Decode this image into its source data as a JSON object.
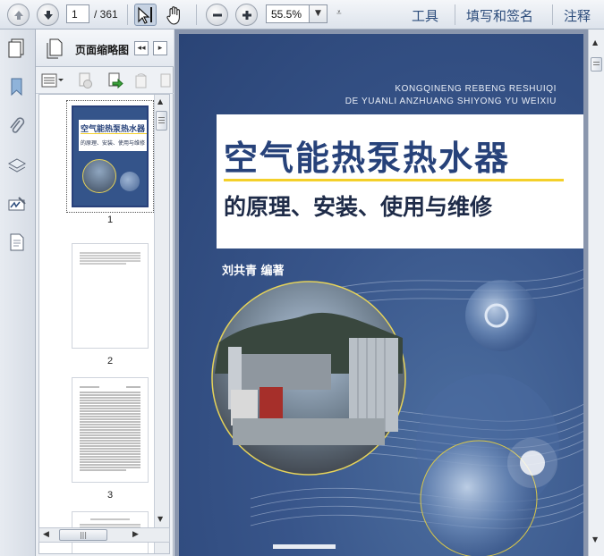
{
  "toolbar": {
    "page_current": "1",
    "page_total": "/ 361",
    "zoom_value": "55.5%",
    "menu_tools": "工具",
    "menu_sign": "填写和签名",
    "menu_comment": "注释",
    "icons": [
      "up-arrow-icon",
      "down-arrow-icon",
      "select-cursor-icon",
      "hand-icon",
      "zoom-out-icon",
      "zoom-in-icon",
      "chevron-down-icon",
      "more-icon"
    ]
  },
  "panel": {
    "title": "页面缩略图",
    "thumbnails": [
      {
        "label": "1"
      },
      {
        "label": "2"
      },
      {
        "label": "3"
      }
    ]
  },
  "cover": {
    "pinyin_line1": "KONGQINENG REBENG RESHUIQI",
    "pinyin_line2": "DE YUANLI ANZHUANG SHIYONG YU WEIXIU",
    "title": "空气能热泵热水器",
    "subtitle": "的原理、安装、使用与维修",
    "author": "刘共青   编著",
    "thumb_title": "空气能热泵热水器",
    "thumb_subtitle": "的原理、安装、使用与维修"
  },
  "colors": {
    "accent_title": "#27427a",
    "cover_bg": "#38558a",
    "rule_yellow": "#f4d02a",
    "menu_text": "#2d4d7c"
  }
}
